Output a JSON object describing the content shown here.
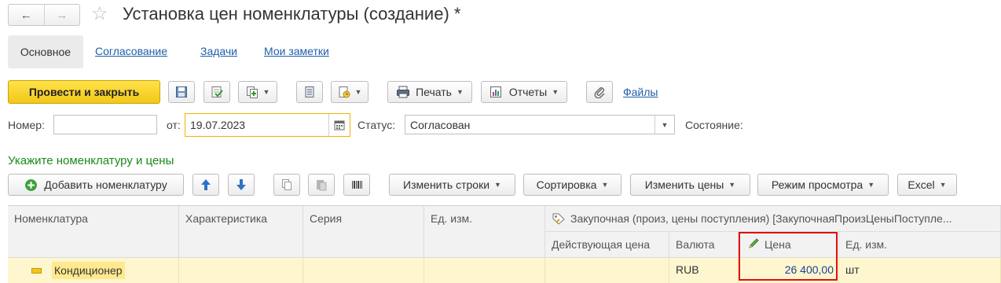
{
  "window": {
    "title": "Установка цен номенклатуры (создание) *",
    "back_icon": "←",
    "forward_icon": "→",
    "star_icon": "☆"
  },
  "tabs": {
    "active": "Основное",
    "links": [
      "Согласование",
      "Задачи",
      "Мои заметки"
    ]
  },
  "toolbar": {
    "post_close": "Провести и закрыть",
    "print": "Печать",
    "reports": "Отчеты",
    "files": "Файлы"
  },
  "fields": {
    "number_label": "Номер:",
    "number_value": "",
    "date_label": "от:",
    "date_value": "19.07.2023",
    "status_label": "Статус:",
    "status_value": "Согласован",
    "state_label": "Состояние:"
  },
  "section": {
    "heading": "Укажите номенклатуру и цены",
    "add_button": "Добавить номенклатуру",
    "change_rows": "Изменить строки",
    "sort": "Сортировка",
    "change_prices": "Изменить цены",
    "view_mode": "Режим просмотра",
    "excel": "Excel"
  },
  "table": {
    "headers": {
      "nomenclature": "Номенклатура",
      "characteristic": "Характеристика",
      "series": "Серия",
      "unit": "Ед. изм.",
      "price_type": "Закупочная (произ, цены поступления) [ЗакупочнаяПроизЦеныПоступле...",
      "current_price": "Действующая цена",
      "currency": "Валюта",
      "price": "Цена",
      "price_unit": "Ед. изм."
    },
    "rows": [
      {
        "nomenclature": "Кондиционер",
        "characteristic": "",
        "series": "",
        "unit": "",
        "current_price": "",
        "currency": "RUB",
        "price": "26 400,00",
        "price_unit": "шт"
      }
    ]
  },
  "colors": {
    "primary_button": "#f5cd1f",
    "link": "#1f5fa8",
    "section_heading": "#1a8a1a",
    "row_highlight": "#fdf6cf",
    "price_cell_border": "#e01010",
    "date_focus_border": "#f0b400"
  }
}
